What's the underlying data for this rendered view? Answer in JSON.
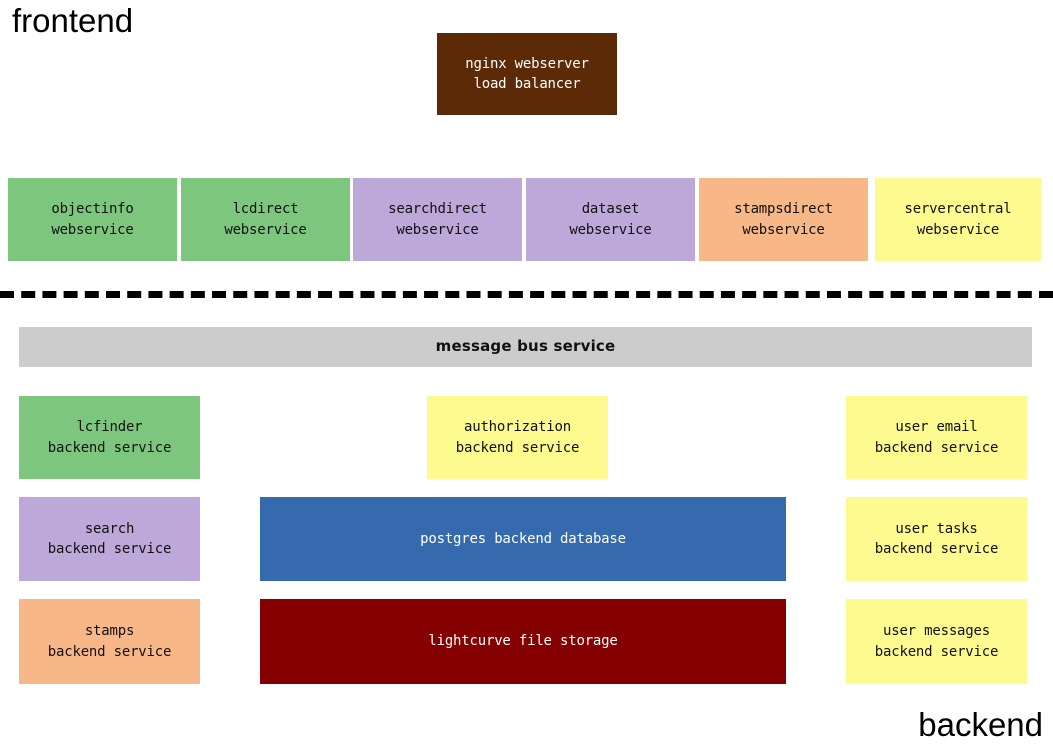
{
  "diagram": {
    "zones": {
      "frontend_label": "frontend",
      "backend_label": "backend"
    },
    "divider": {
      "style": "dashed",
      "color": "#000000"
    },
    "colors": {
      "green": "#7dc67d",
      "purple": "#bda8d9",
      "orange": "#f7b787",
      "yellow": "#fdfa8f",
      "brown": "#5c2a06",
      "blue": "#356aaf",
      "darkred": "#850000",
      "gray": "#cccccc",
      "text_dark": "#111111",
      "text_light": "#ffffff"
    },
    "frontend": {
      "gateway": {
        "line1": "nginx webserver",
        "line2": "load balancer",
        "color": "#5c2a06",
        "text_color": "#ffffff"
      },
      "webservices": [
        {
          "line1": "objectinfo",
          "line2": "webservice",
          "color": "#7dc67d"
        },
        {
          "line1": "lcdirect",
          "line2": "webservice",
          "color": "#7dc67d"
        },
        {
          "line1": "searchdirect",
          "line2": "webservice",
          "color": "#bda8d9"
        },
        {
          "line1": "dataset",
          "line2": "webservice",
          "color": "#bda8d9"
        },
        {
          "line1": "stampsdirect",
          "line2": "webservice",
          "color": "#f7b787"
        },
        {
          "line1": "servercentral",
          "line2": "webservice",
          "color": "#fdfa8f"
        }
      ]
    },
    "backend": {
      "bus": {
        "label": "message bus service",
        "color": "#cccccc",
        "text_color": "#111111"
      },
      "left_column": [
        {
          "line1": "lcfinder",
          "line2": "backend service",
          "color": "#7dc67d"
        },
        {
          "line1": "search",
          "line2": "backend service",
          "color": "#bda8d9"
        },
        {
          "line1": "stamps",
          "line2": "backend service",
          "color": "#f7b787"
        }
      ],
      "center_column": [
        {
          "line1": "authorization",
          "line2": "backend service",
          "color": "#fdfa8f",
          "text_color": "#111111"
        },
        {
          "line1": "postgres backend database",
          "line2": "",
          "color": "#356aaf",
          "text_color": "#ffffff"
        },
        {
          "line1": "lightcurve file storage",
          "line2": "",
          "color": "#850000",
          "text_color": "#ffffff"
        }
      ],
      "right_column": [
        {
          "line1": "user email",
          "line2": "backend service",
          "color": "#fdfa8f"
        },
        {
          "line1": "user tasks",
          "line2": "backend service",
          "color": "#fdfa8f"
        },
        {
          "line1": "user messages",
          "line2": "backend service",
          "color": "#fdfa8f"
        }
      ]
    }
  }
}
